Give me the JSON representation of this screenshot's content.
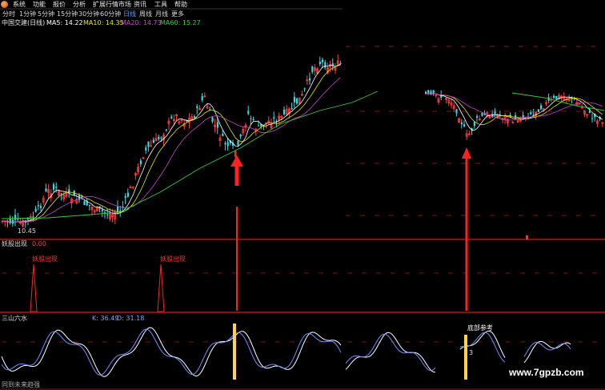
{
  "menu": [
    "系统",
    "功能",
    "报价",
    "分析",
    "扩展行情市场",
    "资讯",
    "工具",
    "帮助"
  ],
  "timeframes": [
    {
      "label": "分时",
      "style": "normal"
    },
    {
      "label": "1分钟",
      "style": "normal"
    },
    {
      "label": "5分钟",
      "style": "normal"
    },
    {
      "label": "15分钟",
      "style": "normal"
    },
    {
      "label": "30分钟",
      "style": "normal"
    },
    {
      "label": "60分钟",
      "style": "normal"
    },
    {
      "label": "日线",
      "style": "blue"
    },
    {
      "label": "周线",
      "style": "normal"
    },
    {
      "label": "月线",
      "style": "normal"
    },
    {
      "label": "更多",
      "style": "normal"
    }
  ],
  "chart": {
    "stock_name": "中国交建(日线)",
    "ma": [
      {
        "name": "MA5",
        "value": "14.22",
        "color": "#ffffff"
      },
      {
        "name": "MA10",
        "value": "14.35",
        "color": "#e6e600"
      },
      {
        "name": "MA20",
        "value": "14.73",
        "color": "#cc44cc"
      },
      {
        "name": "MA60",
        "value": "15.27",
        "color": "#33cc33"
      }
    ],
    "low_price_label": "10.45"
  },
  "signal_panel": {
    "title": "妖股出现",
    "value": "0.00",
    "signal_label_1": "妖股出现",
    "signal_label_2": "妖股出现"
  },
  "kd_panel": {
    "title": "三山六水",
    "k_label": "K: 36.49",
    "d_label": "D: 31.18",
    "bottom_ref": "底部参考",
    "small_mark": "3"
  },
  "watermark": "www.7gpzb.com",
  "bottom_text": "同到未来趋强"
}
